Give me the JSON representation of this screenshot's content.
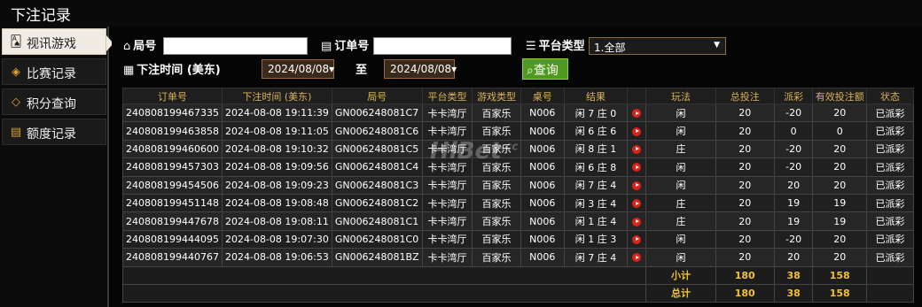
{
  "title": "下注记录",
  "sidebar": {
    "items": [
      {
        "label": "视讯游戏",
        "icon": "cards-icon",
        "active": true
      },
      {
        "label": "比赛记录",
        "icon": "ticket-icon",
        "active": false
      },
      {
        "label": "积分查询",
        "icon": "diamond-icon",
        "active": false
      },
      {
        "label": "额度记录",
        "icon": "document-icon",
        "active": false
      }
    ]
  },
  "filters": {
    "round_label": "局号",
    "round_value": "",
    "order_label": "订单号",
    "order_value": "",
    "platform_label": "平台类型",
    "platform_value": "1.全部",
    "time_label": "下注时间 (美东)",
    "date_from": "2024/08/08",
    "date_to_label": "至",
    "date_to": "2024/08/08",
    "query_button": "查询"
  },
  "table": {
    "headers": [
      "订单号",
      "下注时间 (美东)",
      "局号",
      "平台类型",
      "游戏类型",
      "桌号",
      "结果",
      "",
      "玩法",
      "总投注",
      "派彩",
      "有效投注额",
      "状态"
    ],
    "rows": [
      {
        "order": "240808199467335",
        "time": "2024-08-08 19:11:39",
        "round": "GN006248081C7",
        "platform": "卡卡湾厅",
        "game": "百家乐",
        "table": "N006",
        "result": "闲 7 庄 0",
        "bet": "闲",
        "total": "20",
        "payout": "-20",
        "valid": "20",
        "status": "已派彩"
      },
      {
        "order": "240808199463858",
        "time": "2024-08-08 19:11:05",
        "round": "GN006248081C6",
        "platform": "卡卡湾厅",
        "game": "百家乐",
        "table": "N006",
        "result": "闲 6 庄 6",
        "bet": "闲",
        "total": "20",
        "payout": "0",
        "valid": "0",
        "status": "已派彩"
      },
      {
        "order": "240808199460600",
        "time": "2024-08-08 19:10:32",
        "round": "GN006248081C5",
        "platform": "卡卡湾厅",
        "game": "百家乐",
        "table": "N006",
        "result": "闲 8 庄 1",
        "bet": "庄",
        "total": "20",
        "payout": "-20",
        "valid": "20",
        "status": "已派彩"
      },
      {
        "order": "240808199457303",
        "time": "2024-08-08 19:09:56",
        "round": "GN006248081C4",
        "platform": "卡卡湾厅",
        "game": "百家乐",
        "table": "N006",
        "result": "闲 6 庄 8",
        "bet": "闲",
        "total": "20",
        "payout": "-20",
        "valid": "20",
        "status": "已派彩"
      },
      {
        "order": "240808199454506",
        "time": "2024-08-08 19:09:23",
        "round": "GN006248081C3",
        "platform": "卡卡湾厅",
        "game": "百家乐",
        "table": "N006",
        "result": "闲 7 庄 4",
        "bet": "闲",
        "total": "20",
        "payout": "20",
        "valid": "20",
        "status": "已派彩"
      },
      {
        "order": "240808199451148",
        "time": "2024-08-08 19:08:48",
        "round": "GN006248081C2",
        "platform": "卡卡湾厅",
        "game": "百家乐",
        "table": "N006",
        "result": "闲 3 庄 4",
        "bet": "庄",
        "total": "20",
        "payout": "19",
        "valid": "19",
        "status": "已派彩"
      },
      {
        "order": "240808199447678",
        "time": "2024-08-08 19:08:11",
        "round": "GN006248081C1",
        "platform": "卡卡湾厅",
        "game": "百家乐",
        "table": "N006",
        "result": "闲 1 庄 4",
        "bet": "庄",
        "total": "20",
        "payout": "19",
        "valid": "19",
        "status": "已派彩"
      },
      {
        "order": "240808199444095",
        "time": "2024-08-08 19:07:30",
        "round": "GN006248081C0",
        "platform": "卡卡湾厅",
        "game": "百家乐",
        "table": "N006",
        "result": "闲 1 庄 3",
        "bet": "闲",
        "total": "20",
        "payout": "-20",
        "valid": "20",
        "status": "已派彩"
      },
      {
        "order": "240808199440767",
        "time": "2024-08-08 19:06:53",
        "round": "GN006248081BZ",
        "platform": "卡卡湾厅",
        "game": "百家乐",
        "table": "N006",
        "result": "闲 7 庄 4",
        "bet": "闲",
        "total": "20",
        "payout": "20",
        "valid": "20",
        "status": "已派彩"
      }
    ],
    "subtotal": {
      "label": "小计",
      "total": "180",
      "payout": "38",
      "valid": "158"
    },
    "grand_total": {
      "label": "总计",
      "total": "180",
      "payout": "38",
      "valid": "158"
    }
  },
  "watermark": {
    "main": "HiBet",
    "suffix": ".cc"
  },
  "colors": {
    "accent": "#d9b35a",
    "win": "#e23b3b",
    "loss": "#4ad84a",
    "query": "#4f9a1e"
  }
}
